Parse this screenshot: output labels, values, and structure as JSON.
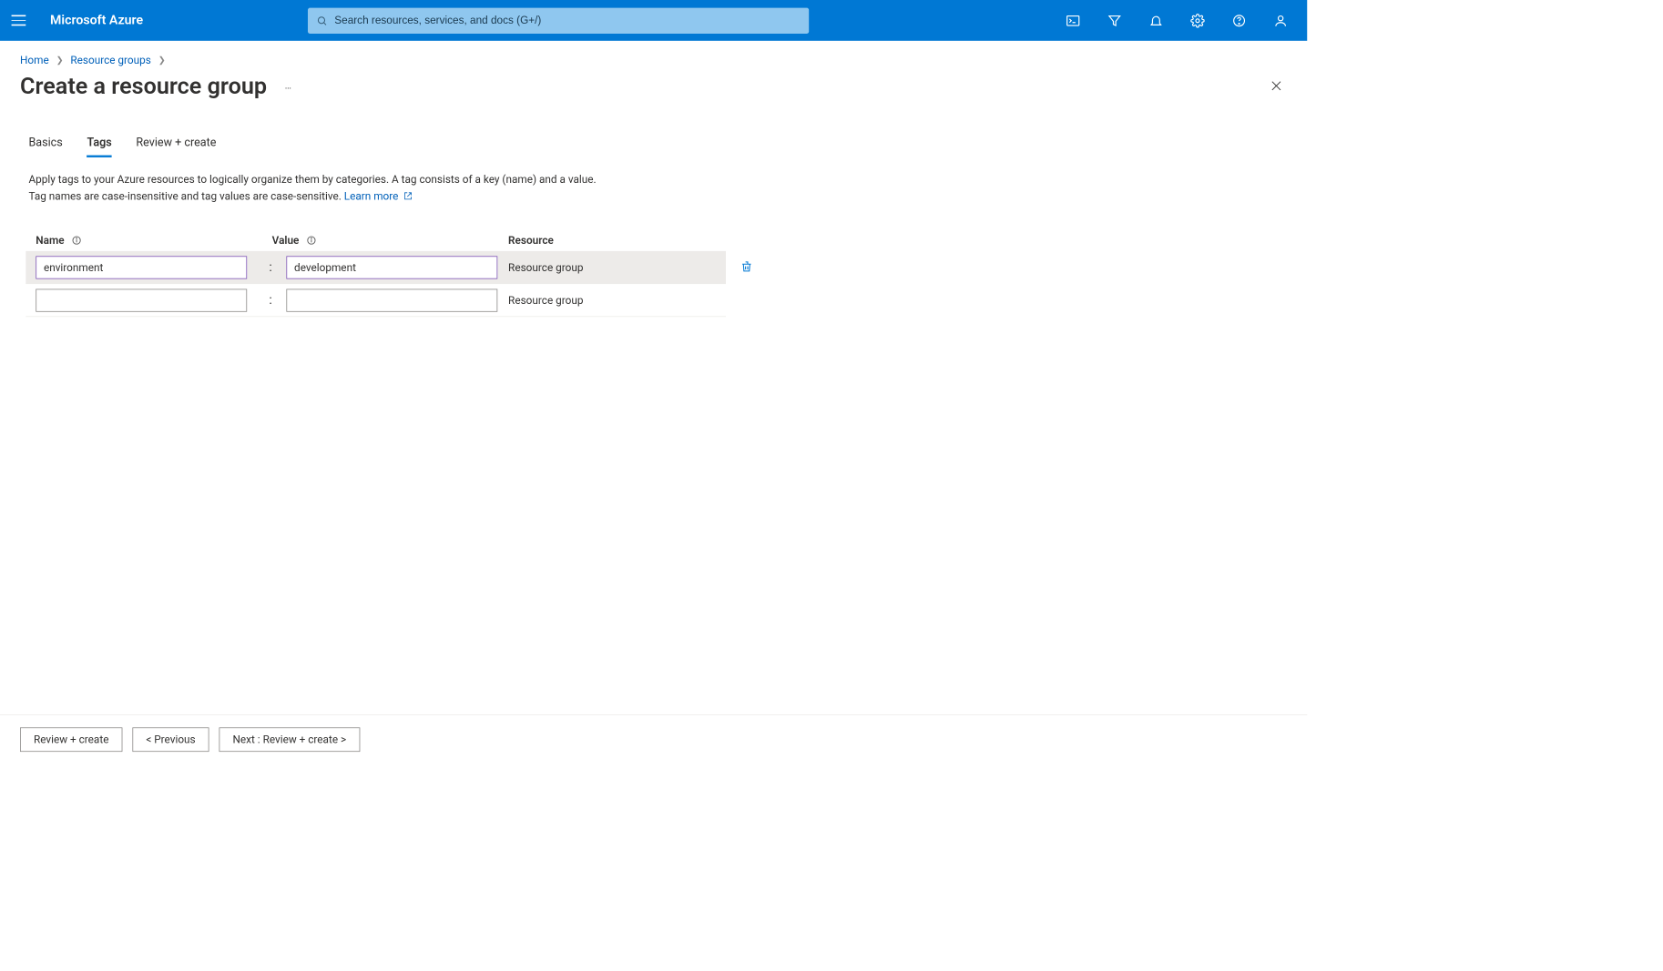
{
  "header": {
    "brand": "Microsoft Azure",
    "search_placeholder": "Search resources, services, and docs (G+/)"
  },
  "breadcrumb": {
    "items": [
      "Home",
      "Resource groups"
    ]
  },
  "page": {
    "title": "Create a resource group"
  },
  "tabs": {
    "items": [
      "Basics",
      "Tags",
      "Review + create"
    ],
    "active": "Tags"
  },
  "description": {
    "line1": "Apply tags to your Azure resources to logically organize them by categories. A tag consists of a key (name) and a value.",
    "line2_prefix": "Tag names are case-insensitive and tag values are case-sensitive. ",
    "learn_more": "Learn more"
  },
  "tag_table": {
    "headers": {
      "name": "Name",
      "value": "Value",
      "resource": "Resource"
    },
    "rows": [
      {
        "name": "environment",
        "value": "development",
        "resource": "Resource group",
        "deletable": true
      },
      {
        "name": "",
        "value": "",
        "resource": "Resource group",
        "deletable": false
      }
    ]
  },
  "footer": {
    "review_create": "Review + create",
    "previous": "< Previous",
    "next": "Next : Review + create >"
  }
}
